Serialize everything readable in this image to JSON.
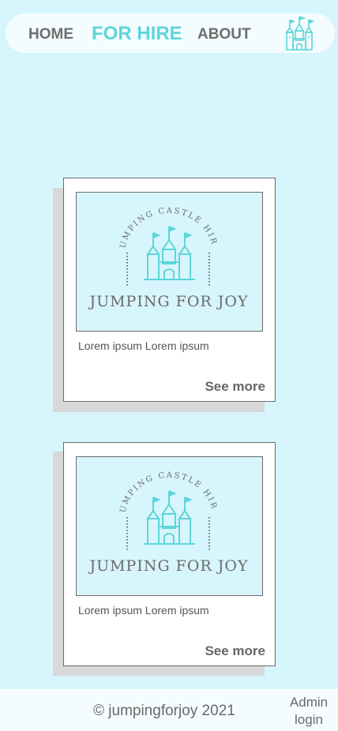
{
  "nav": {
    "home": "HOME",
    "for_hire": "FOR HIRE",
    "about": "ABOUT",
    "logo_icon": "castle-icon"
  },
  "cards": [
    {
      "arc_text": "JUMPING CASTLE HIRE",
      "brand": "JUMPING FOR JOY",
      "text": "Lorem ipsum Lorem ipsum",
      "more": "See more"
    },
    {
      "arc_text": "JUMPING CASTLE HIRE",
      "brand": "JUMPING FOR JOY",
      "text": "Lorem ipsum Lorem ipsum",
      "more": "See more"
    }
  ],
  "footer": {
    "copyright": "© jumpingforjoy 2021",
    "admin_line1": "Admin",
    "admin_line2": "login"
  },
  "colors": {
    "background": "#d7f5fc",
    "accent": "#5dd6d9",
    "text": "#6e6e6e"
  }
}
